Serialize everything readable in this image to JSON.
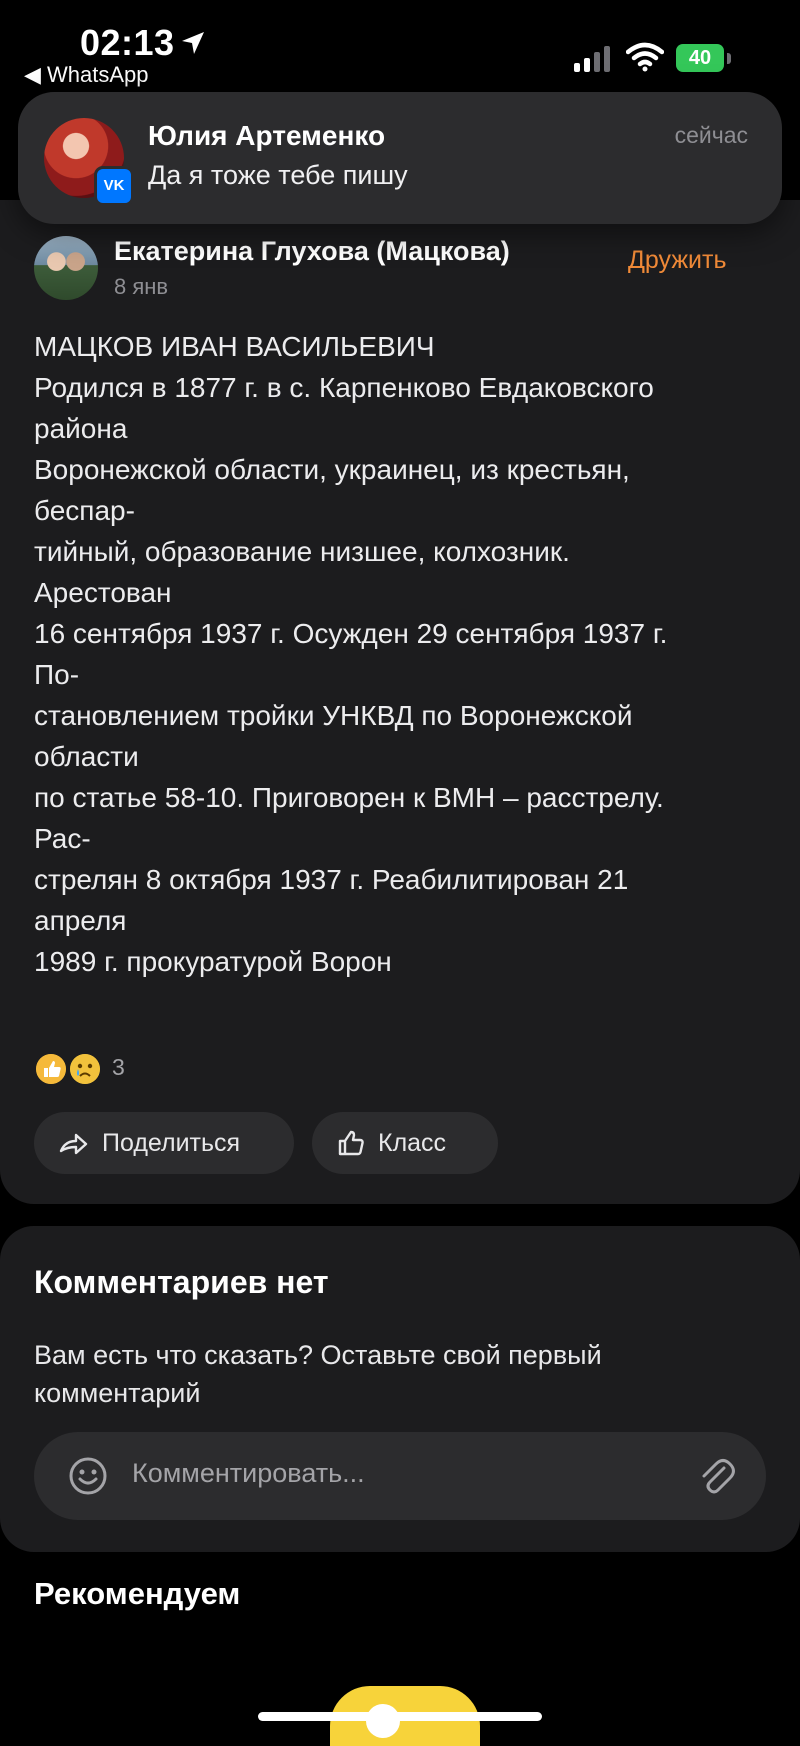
{
  "status_bar": {
    "time": "02:13",
    "back_app": "◀ WhatsApp",
    "battery": "40"
  },
  "notification": {
    "sender": "Юлия Артеменко",
    "message": "Да я тоже тебе пишу",
    "time": "сейчас",
    "app_badge": "VK"
  },
  "post": {
    "author": "Екатерина Глухова (Мацкова)",
    "date": "8 янв",
    "friend_button": "Дружить",
    "lines": [
      "МАЦКОВ ИВАН ВАСИЛЬЕВИЧ",
      "Родился в 1877 г. в с. Карпенково Евдаковского",
      "района",
      "Воронежской области, украинец, из крестьян,",
      "беспар-",
      "тийный, образование низшее, колхозник.",
      "Арестован",
      "16 сентября 1937 г. Осужден 29 сентября 1937 г.",
      "По-",
      "становлением тройки УНКВД по Воронежской",
      "области",
      "по статье 58-10. Приговорен к ВМН – расстрелу.",
      "Рас-",
      "стрелян 8 октября 1937 г. Реабилитирован 21",
      "апреля",
      "1989 г. прокуратурой Ворон"
    ],
    "reactions_count": "3",
    "share_label": "Поделиться",
    "class_label": "Класс"
  },
  "comments": {
    "title": "Комментариев нет",
    "subtitle": "Вам есть что сказать? Оставьте свой первый комментарий",
    "placeholder": "Комментировать..."
  },
  "recommend": {
    "title": "Рекомендуем"
  },
  "colors": {
    "accent_orange": "#f08a38",
    "card_bg": "#1c1c1e",
    "vk_blue": "#0077ff",
    "battery_green": "#34c759"
  }
}
